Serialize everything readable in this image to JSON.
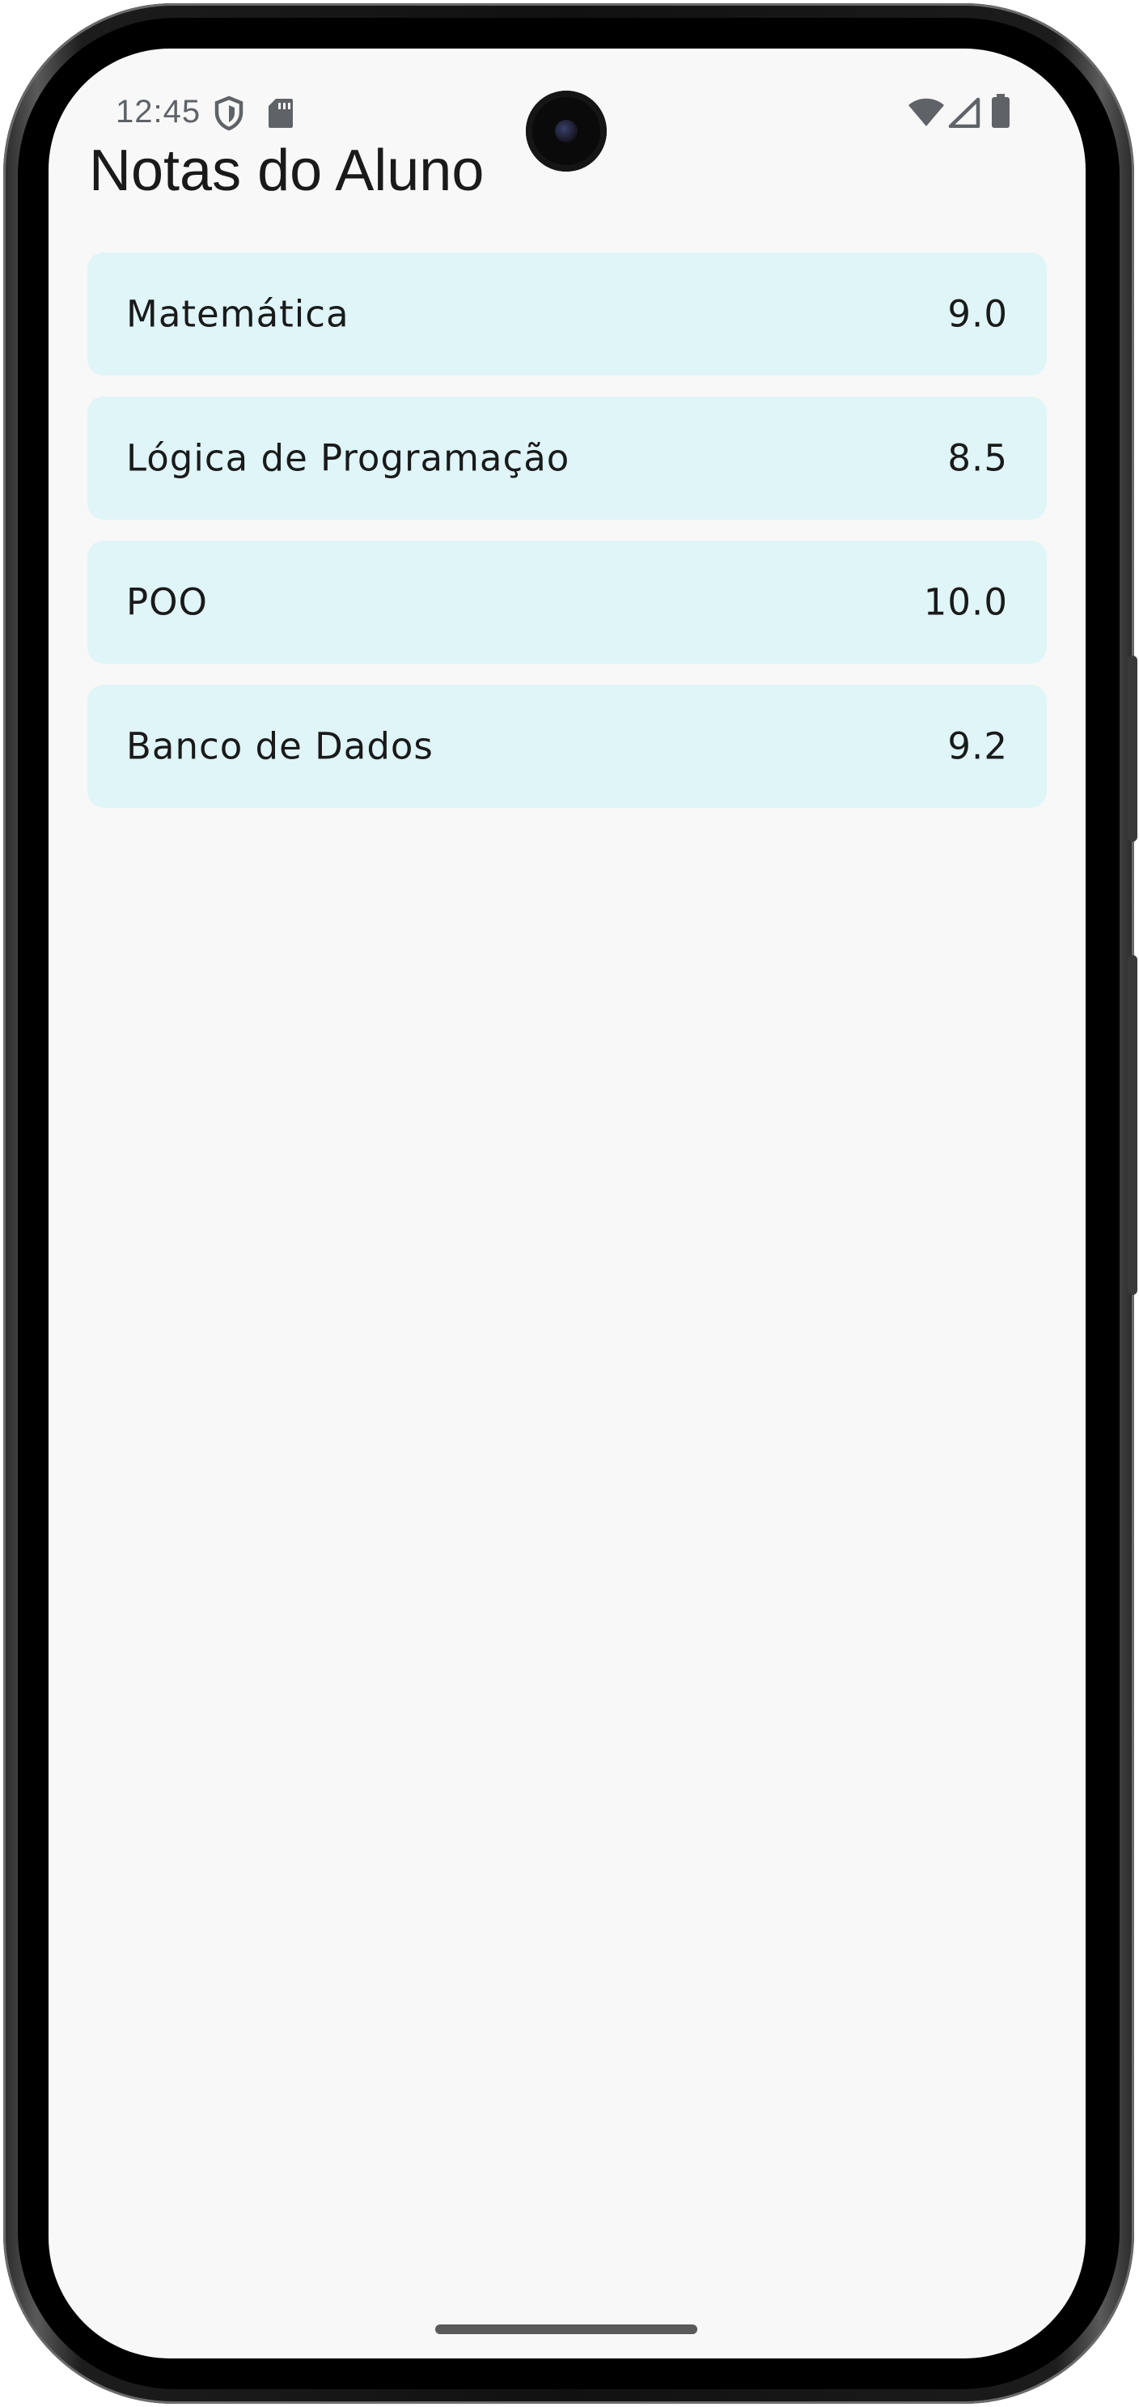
{
  "status_bar": {
    "time": "12:45",
    "left_icons": [
      "shield-icon",
      "sd-card-icon"
    ],
    "right_icons": [
      "wifi-icon",
      "cell-signal-icon",
      "battery-icon"
    ]
  },
  "app": {
    "title": "Notas do Aluno",
    "grades": [
      {
        "subject": "Matemática",
        "grade": "9.0"
      },
      {
        "subject": "Lógica de Programação",
        "grade": "8.5"
      },
      {
        "subject": "POO",
        "grade": "10.0"
      },
      {
        "subject": "Banco de Dados",
        "grade": "9.2"
      }
    ]
  },
  "colors": {
    "card_background": "#dff5f8",
    "screen_background": "#f8f8f8",
    "text": "#1a1a1a",
    "status_text": "#5f6368"
  }
}
